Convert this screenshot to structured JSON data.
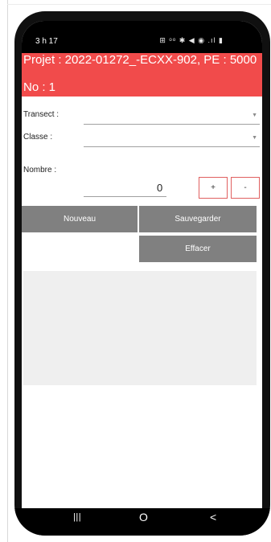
{
  "status_bar": {
    "time": "3 h 17",
    "icons": "⊞ ᵒᵒ    ✱ ◀ ◉ .ıl ▮"
  },
  "header": {
    "project_line": "Projet : 2022-01272_-ECXX-902, PE : 5000",
    "number_line": "No :    1"
  },
  "form": {
    "transect_label": "Transect :",
    "classe_label": "Classe :",
    "nombre_label": "Nombre :",
    "nombre_value": "0",
    "plus_label": "+",
    "minus_label": "-"
  },
  "actions": {
    "nouveau": "Nouveau",
    "sauvegarder": "Sauvegarder",
    "effacer": "Effacer"
  },
  "nav": {
    "recents": "|||",
    "home": "O",
    "back": "<"
  },
  "colors": {
    "header": "#f14b4b",
    "button": "#808080",
    "list_bg": "#efefef"
  }
}
